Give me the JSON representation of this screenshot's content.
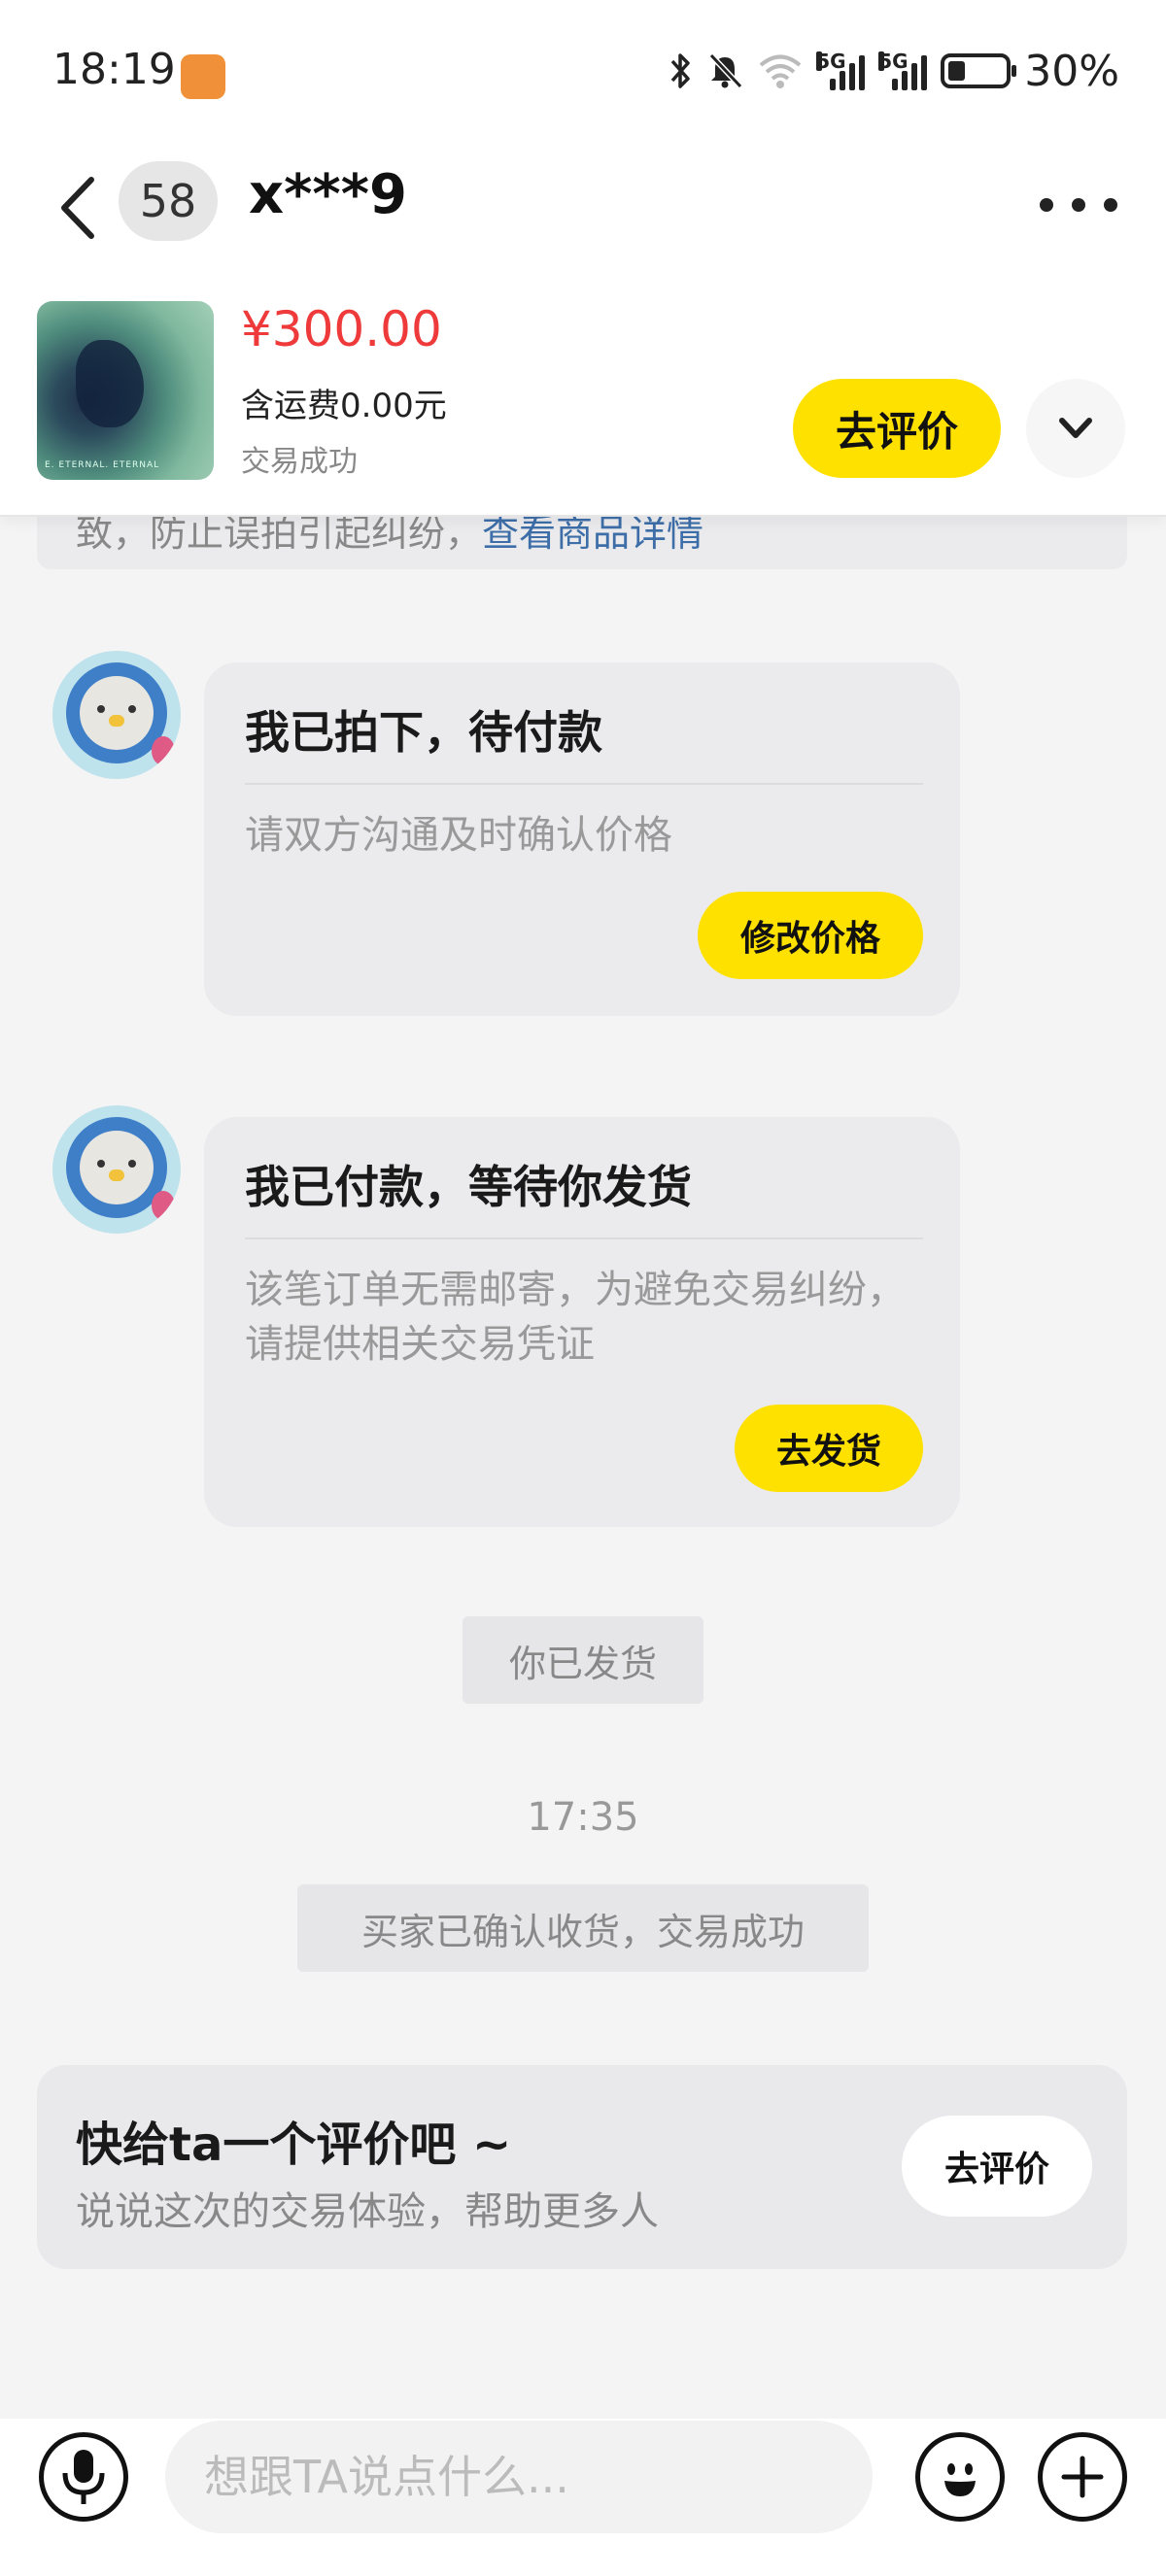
{
  "status_bar": {
    "time": "18:19",
    "network_1": "5G",
    "network_2": "5G",
    "battery_percent": "30%",
    "battery_level": 0.3
  },
  "header": {
    "unread_count": "58",
    "title": "x***9"
  },
  "product": {
    "price": "¥300.00",
    "shipping": "含运费0.00元",
    "status": "交易成功",
    "thumb_caption": "E. ETERNAL. ETERNAL",
    "review_button": "去评价"
  },
  "chat": {
    "notice_text": "致，防止误拍引起纠纷，",
    "notice_link": "查看商品详情",
    "messages": [
      {
        "title": "我已拍下，待付款",
        "desc": "请双方沟通及时确认价格",
        "button": "修改价格"
      },
      {
        "title": "我已付款，等待你发货",
        "desc": "该笔订单无需邮寄，为避免交易纠纷，请提供相关交易凭证",
        "button": "去发货"
      }
    ],
    "system_shipped": "你已发货",
    "timestamp": "17:35",
    "system_confirmed": "买家已确认收货，交易成功",
    "review_card": {
      "title": "快给ta一个评价吧 ~",
      "subtitle": "说说这次的交易体验，帮助更多人",
      "button": "去评价"
    }
  },
  "input_bar": {
    "placeholder": "想跟TA说点什么..."
  },
  "colors": {
    "accent_yellow": "#ffe100",
    "price_red": "#ee3a3a",
    "link_blue": "#3d6ea8",
    "chat_background": "#f4f4f5"
  },
  "icons": {
    "back": "chevron-left-icon",
    "more": "more-dots-icon",
    "expand": "chevron-down-icon",
    "voice": "microphone-icon",
    "emoji": "emoji-icon",
    "plus": "plus-icon"
  }
}
